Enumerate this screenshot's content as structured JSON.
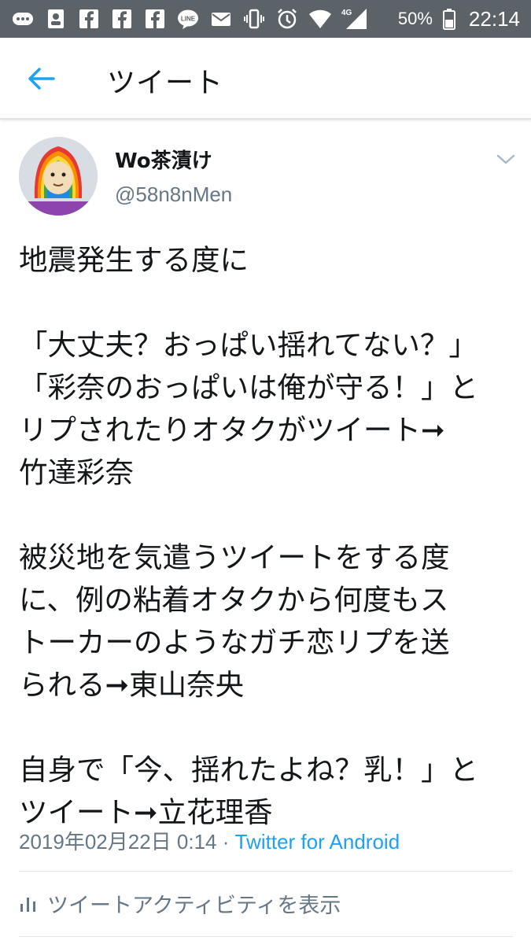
{
  "status_bar": {
    "network_label": "4G",
    "battery": "50%",
    "time": "22:14",
    "left_icons": [
      "chat-bubble-icon",
      "contact-icon",
      "facebook-icon",
      "facebook-icon",
      "facebook-icon",
      "line-icon",
      "mail-icon",
      "vibrate-icon",
      "alarm-icon",
      "wifi-icon",
      "signal-icon",
      "battery-icon"
    ]
  },
  "header": {
    "title": "ツイート"
  },
  "tweet": {
    "display_name": "Wo茶漬け",
    "handle": "@58n8nMen",
    "lines": [
      "地震発生する度に",
      "",
      "「大丈夫？おっぱい揺れてない？」",
      "「彩奈のおっぱいは俺が守る！」と",
      "リプされたりオタクがツイート➞",
      "竹達彩奈",
      "",
      "被災地を気遣うツイートをする度",
      "に、例の粘着オタクから何度もス",
      "トーカーのようなガチ恋リプを送",
      "られる➞東山奈央",
      "",
      "自身で「今、揺れたよね？乳！」と",
      "ツイート➞立花理香"
    ],
    "timestamp": "2019年02月22日 0:14",
    "separator": " · ",
    "source": "Twitter for Android",
    "activity_label": "ツイートアクティビティを表示"
  },
  "colors": {
    "status_bar_bg": "#5c6368",
    "accent": "#1da1f2",
    "secondary_text": "#657786",
    "primary_text": "#14171a"
  }
}
